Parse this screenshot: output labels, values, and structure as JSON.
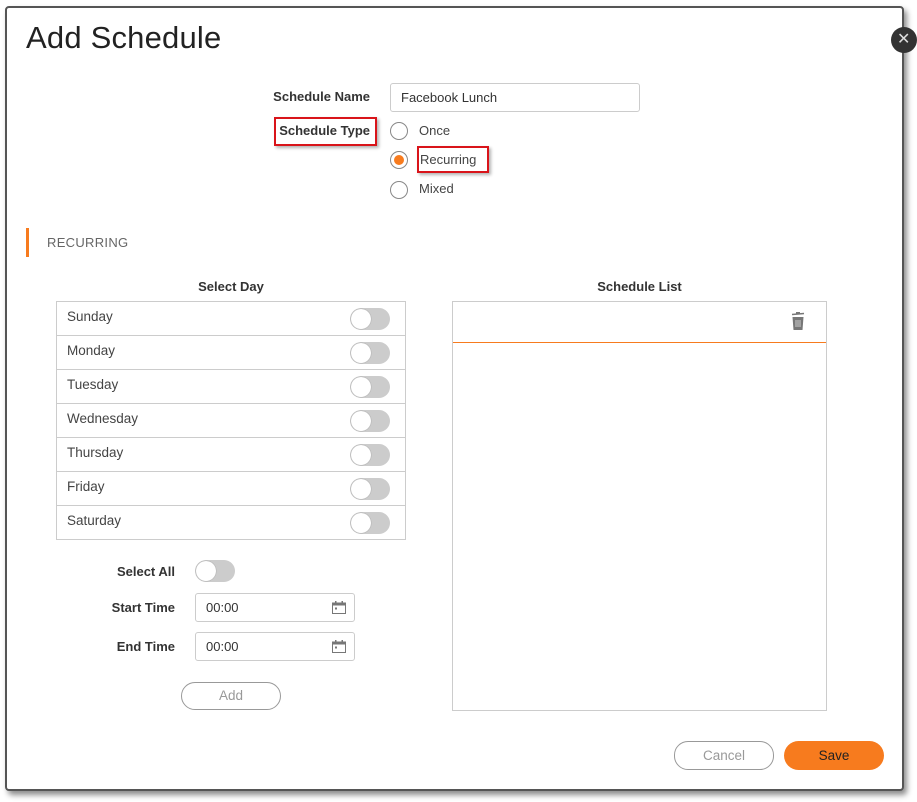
{
  "dialog": {
    "title": "Add Schedule",
    "close_icon": "close-icon"
  },
  "form": {
    "schedule_name_label": "Schedule Name",
    "schedule_name_value": "Facebook Lunch",
    "schedule_type_label": "Schedule Type",
    "schedule_type_options": [
      {
        "label": "Once",
        "selected": false
      },
      {
        "label": "Recurring",
        "selected": true
      },
      {
        "label": "Mixed",
        "selected": false
      }
    ]
  },
  "section": {
    "title": "RECURRING"
  },
  "select_day": {
    "heading": "Select Day",
    "days": [
      {
        "label": "Sunday",
        "enabled": false
      },
      {
        "label": "Monday",
        "enabled": false
      },
      {
        "label": "Tuesday",
        "enabled": false
      },
      {
        "label": "Wednesday",
        "enabled": false
      },
      {
        "label": "Thursday",
        "enabled": false
      },
      {
        "label": "Friday",
        "enabled": false
      },
      {
        "label": "Saturday",
        "enabled": false
      }
    ],
    "select_all_label": "Select All",
    "select_all_enabled": false,
    "start_time_label": "Start Time",
    "start_time_value": "00:00",
    "end_time_label": "End Time",
    "end_time_value": "00:00",
    "add_label": "Add"
  },
  "schedule_list": {
    "heading": "Schedule List",
    "items": []
  },
  "footer": {
    "cancel_label": "Cancel",
    "save_label": "Save"
  },
  "colors": {
    "accent": "#f77b1e",
    "highlight_box": "#d9141a"
  }
}
